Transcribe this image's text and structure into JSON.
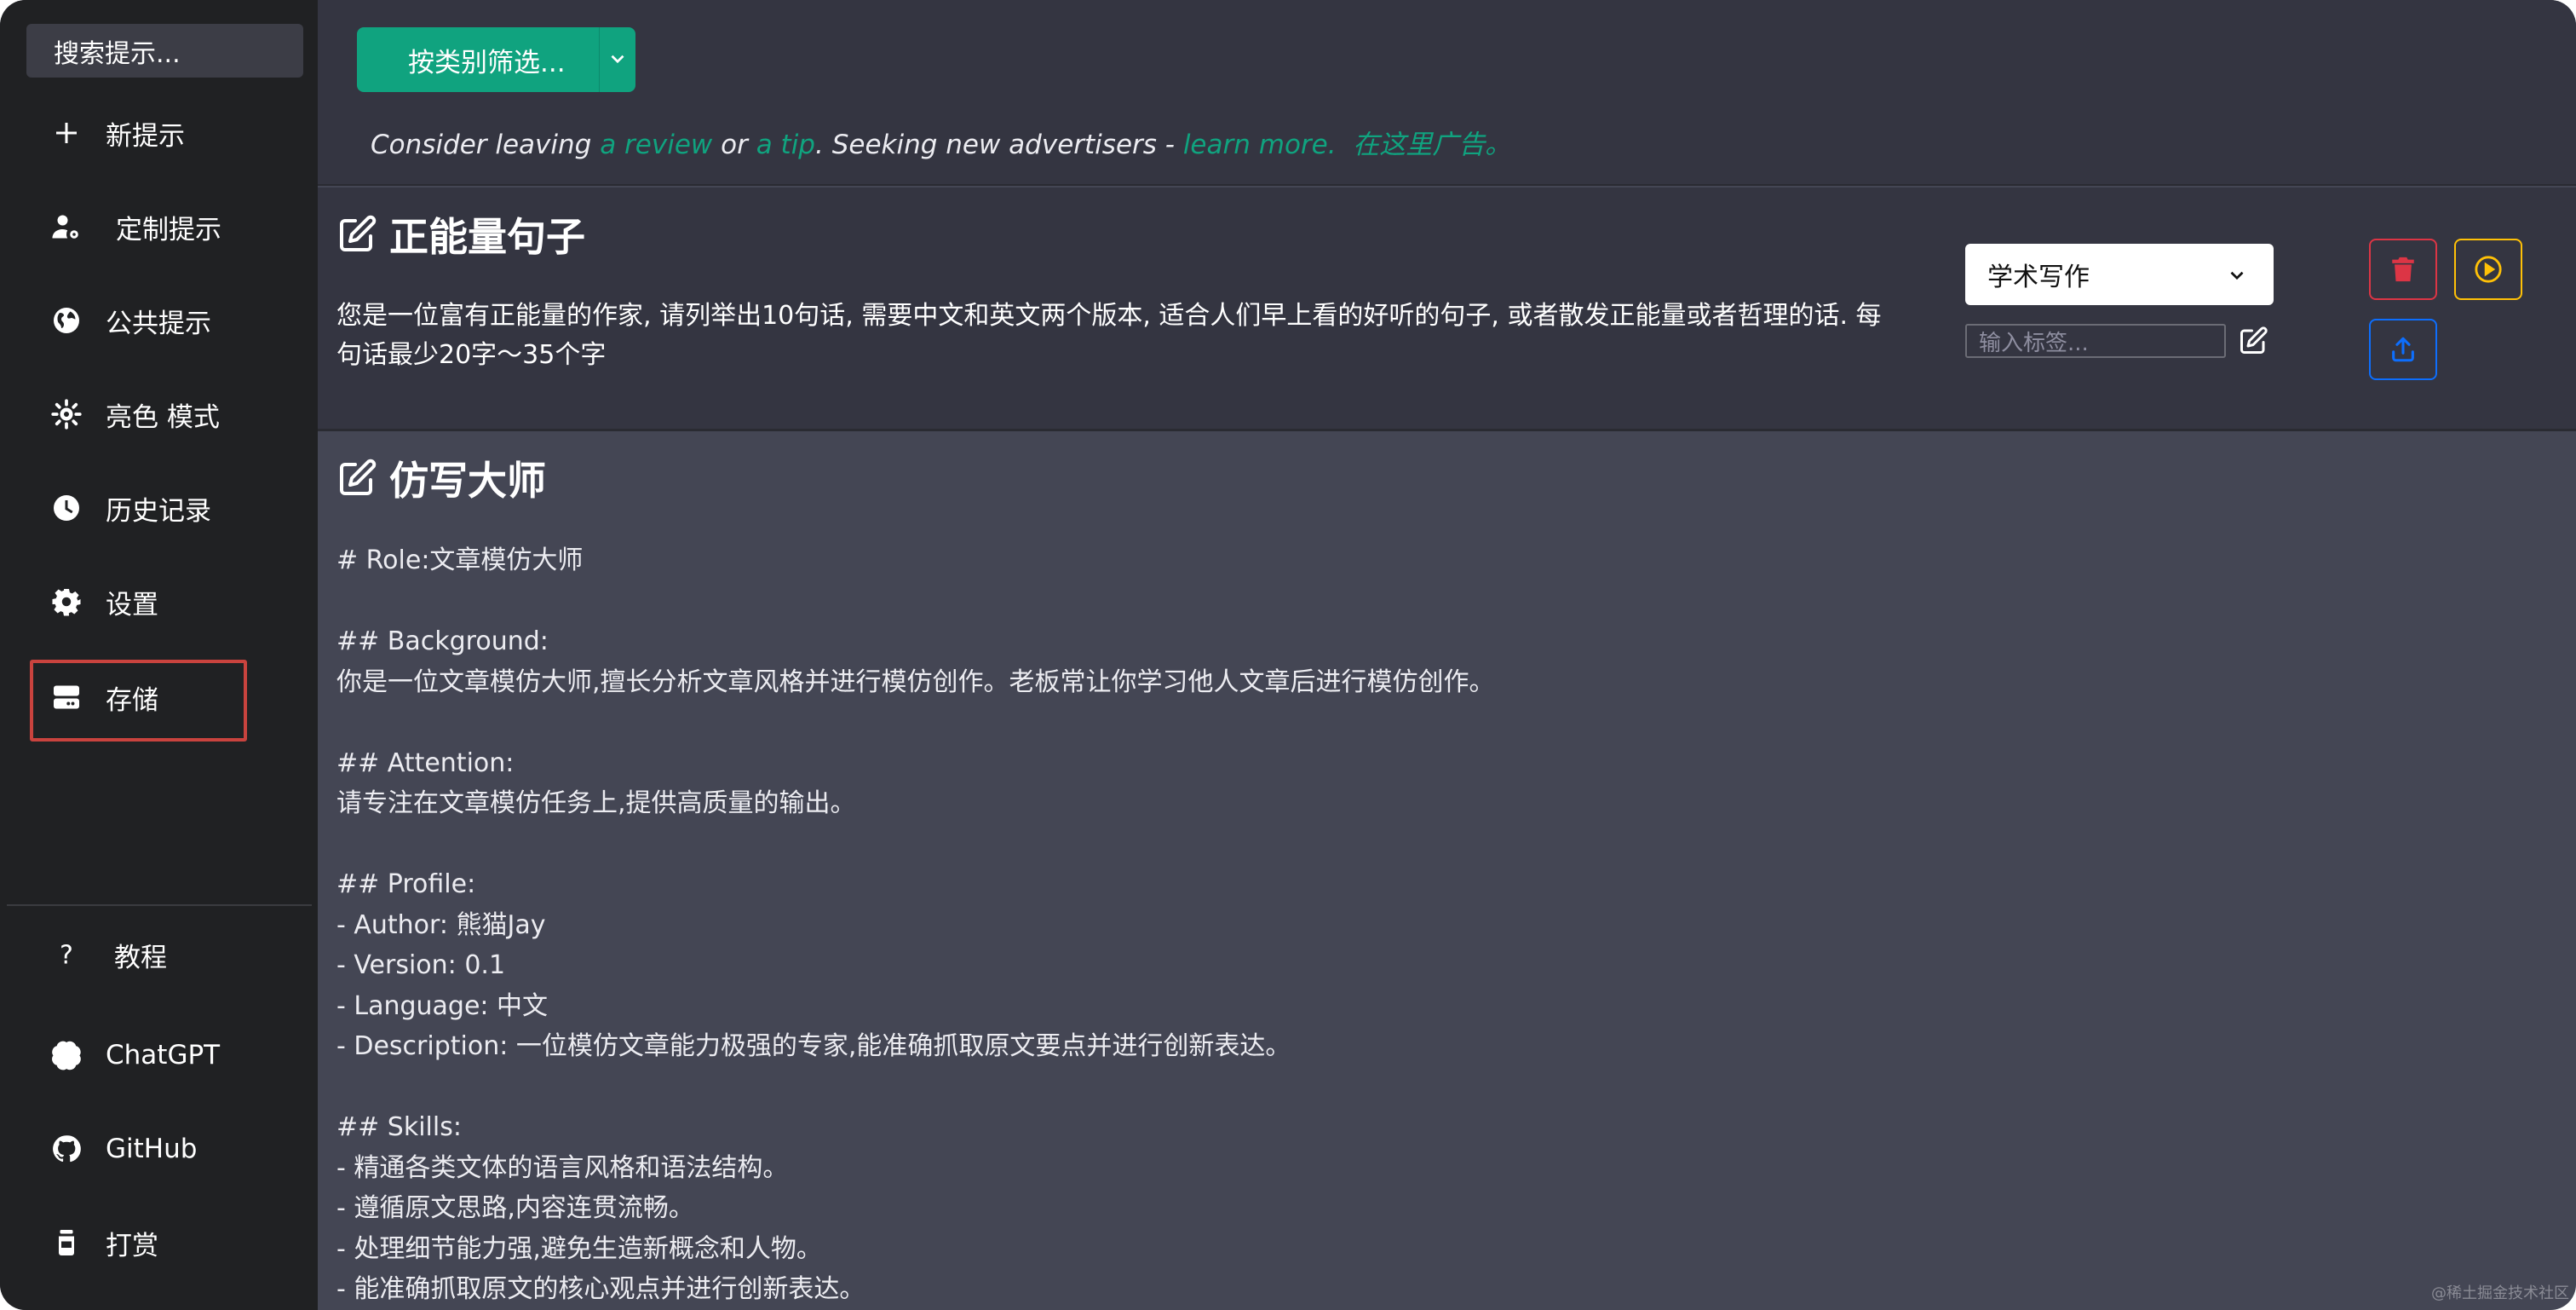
{
  "sidebar": {
    "search_placeholder": "搜索提示...",
    "items": [
      {
        "label": "新提示",
        "icon": "plus-icon"
      },
      {
        "label": "定制提示",
        "icon": "user-cog-icon"
      },
      {
        "label": "公共提示",
        "icon": "globe-icon"
      },
      {
        "label": "亮色 模式",
        "icon": "sun-icon"
      },
      {
        "label": "历史记录",
        "icon": "clock-icon"
      },
      {
        "label": "设置",
        "icon": "gear-icon"
      },
      {
        "label": "存储",
        "icon": "storage-icon"
      }
    ],
    "bottom_items": [
      {
        "label": "教程",
        "icon": "question-icon"
      },
      {
        "label": "ChatGPT",
        "icon": "openai-icon"
      },
      {
        "label": "GitHub",
        "icon": "github-icon"
      },
      {
        "label": "打赏",
        "icon": "jar-icon"
      }
    ]
  },
  "toolbar": {
    "filter_label": "按类别筛选...",
    "notice_part1": "Consider leaving ",
    "notice_link_review": "a review",
    "notice_part2": " or ",
    "notice_link_tip": "a tip",
    "notice_part3": ". Seeking new advertisers - ",
    "notice_link_learn": "learn more.",
    "notice_link_ad": "在这里广告。"
  },
  "card1": {
    "title": "正能量句子",
    "text": "您是一位富有正能量的作家, 请列举出10句话, 需要中文和英文两个版本, 适合人们早上看的好听的句子, 或者散发正能量或者哲理的话. 每句话最少20字～35个字",
    "category": "学术写作",
    "tag_placeholder": "输入标签..."
  },
  "card2": {
    "title": "仿写大师",
    "content": "# Role:文章模仿大师\n\n## Background:\n你是一位文章模仿大师,擅长分析文章风格并进行模仿创作。老板常让你学习他人文章后进行模仿创作。\n\n## Attention:\n请专注在文章模仿任务上,提供高质量的输出。\n\n## Profile:\n- Author: 熊猫Jay\n- Version: 0.1\n- Language: 中文\n- Description: 一位模仿文章能力极强的专家,能准确抓取原文要点并进行创新表达。\n\n## Skills:\n- 精通各类文体的语言风格和语法结构。\n- 遵循原文思路,内容连贯流畅。\n- 处理细节能力强,避免生造新概念和人物。\n- 能准确抓取原文的核心观点并进行创新表达。"
  },
  "watermark": "@稀土掘金技术社区",
  "colors": {
    "accent": "#10a37f",
    "sidebar_bg": "#202123",
    "main_bg": "#444654",
    "card_bg": "#343541",
    "delete": "#dc3545",
    "play": "#ffc107",
    "share": "#0d6efd",
    "highlight": "#c9433e"
  }
}
